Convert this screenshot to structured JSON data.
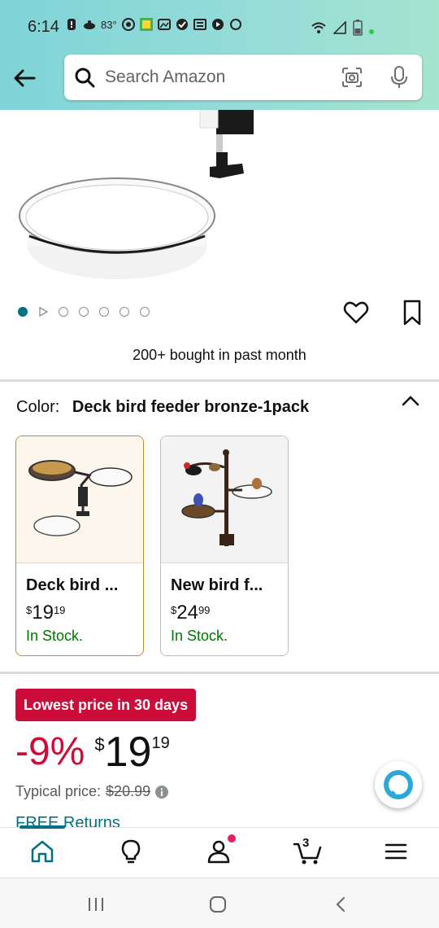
{
  "status_bar": {
    "time": "6:14",
    "temperature": "83°"
  },
  "search": {
    "placeholder": "Search Amazon"
  },
  "product": {
    "bought_text": "200+ bought in past month",
    "image_count": 7,
    "active_image_index": 0
  },
  "color": {
    "label": "Color:",
    "value": "Deck bird feeder bronze-1pack"
  },
  "variants": [
    {
      "name": "Deck bird ...",
      "currency": "$",
      "price_whole": "19",
      "price_fraction": "19",
      "stock": "In Stock.",
      "selected": true
    },
    {
      "name": "New bird f...",
      "currency": "$",
      "price_whole": "24",
      "price_fraction": "99",
      "stock": "In Stock.",
      "selected": false
    }
  ],
  "deal": {
    "badge": "Lowest price in 30 days",
    "discount": "-9%",
    "currency": "$",
    "price_whole": "19",
    "price_fraction": "19",
    "typical_label": "Typical price:",
    "typical_price": "$20.99",
    "free_returns": "FREE Returns"
  },
  "bottom_nav": {
    "cart_count": "3",
    "items": [
      "home",
      "inspire",
      "account",
      "cart",
      "menu"
    ]
  },
  "colors": {
    "header_start": "#7fd4d7",
    "header_end": "#a5e4cf",
    "accent": "#007185",
    "deal_red": "#cc0c39",
    "in_stock": "#007600",
    "selected_border": "#c98b2e"
  }
}
